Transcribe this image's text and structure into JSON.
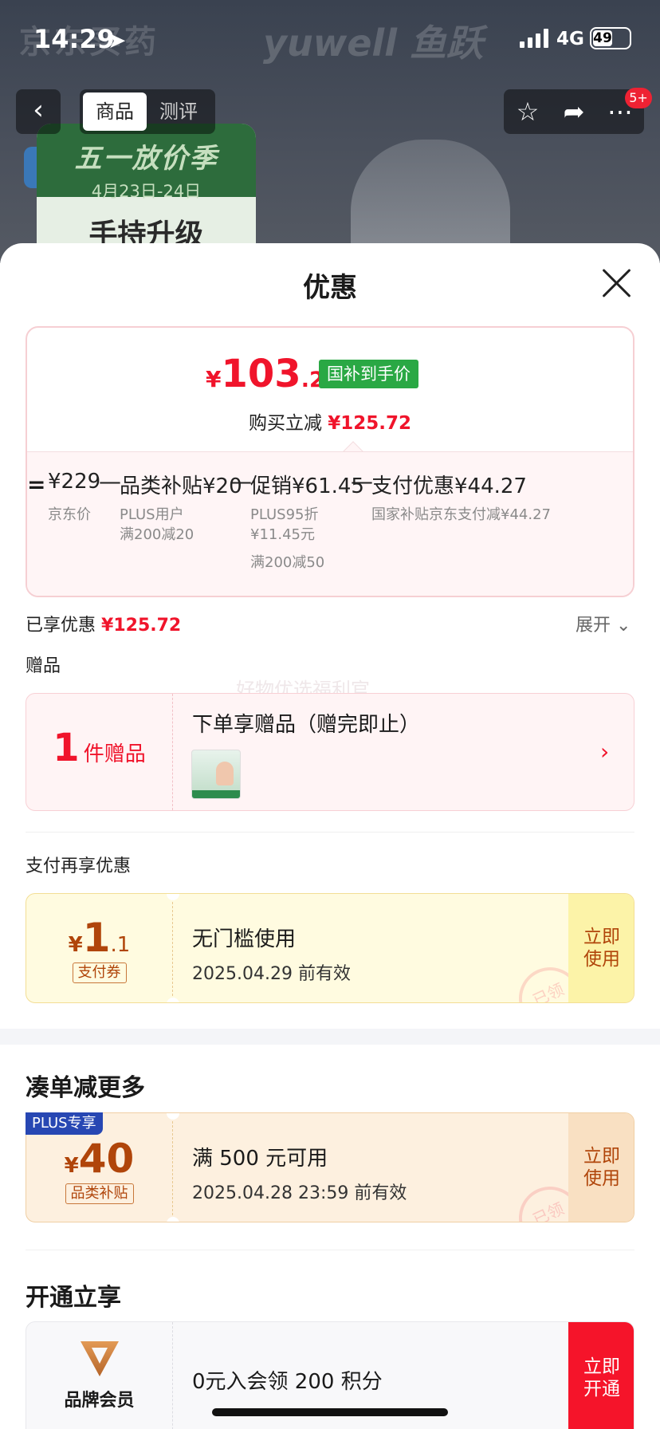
{
  "status_bar": {
    "time": "14:29",
    "network": "4G",
    "battery": "49"
  },
  "background": {
    "brand_left": "京东买药",
    "brand_right": "yuwell 鱼跃",
    "promo_title": "五一放价季",
    "promo_date": "4月23日-24日",
    "promo_sub": "手持升级"
  },
  "nav": {
    "tabs": [
      {
        "label": "商品"
      },
      {
        "label": "测评"
      }
    ],
    "badge": "5+"
  },
  "sheet": {
    "title": "优惠",
    "final_price": {
      "currency": "¥",
      "integer": "103",
      "decimal": ".28",
      "badge": "国补到手价",
      "sub_label": "购买立减",
      "sub_value": "¥125.72"
    },
    "breakdown": {
      "eq": "=",
      "jd_price": "¥229",
      "jd_price_label": "京东价",
      "cat_subsidy": "品类补贴¥20",
      "cat_note_1": "PLUS用户",
      "cat_note_2": "满200减20",
      "promo": "促销¥61.45",
      "promo_note_1": "PLUS95折",
      "promo_note_2": "¥11.45元",
      "promo_note_3": "满200减50",
      "pay": "支付优惠¥44.27",
      "pay_note": "国家补贴京东支付减¥44.27",
      "minus": "—"
    },
    "saved": {
      "label": "已享优惠",
      "value": "¥125.72",
      "expand": "展开"
    },
    "gift": {
      "heading": "赠品",
      "watermark": "好物优选福利官",
      "count": "1",
      "count_label": "件赠品",
      "title": "下单享赠品（赠完即止）"
    },
    "pay_section": {
      "heading": "支付再享优惠",
      "coupon": {
        "currency": "¥",
        "amount": "1",
        "decimal": ".1",
        "tag": "支付券",
        "main": "无门槛使用",
        "sub": "2025.04.29 前有效",
        "button": "立即\n使用",
        "stamp": "已领"
      }
    },
    "more_section": {
      "heading": "凑单减更多",
      "plus_tag": "PLUS专享",
      "coupon": {
        "currency": "¥",
        "amount": "40",
        "tag": "品类补贴",
        "main": "满 500 元可用",
        "sub": "2025.04.28 23:59 前有效",
        "button": "立即\n使用",
        "stamp": "已领"
      }
    },
    "open_section": {
      "heading": "开通立享",
      "member": {
        "label": "品牌会员",
        "text": "0元入会领 200 积分",
        "button": "立即\n开通"
      }
    }
  },
  "colors": {
    "accent_red": "#f0142b",
    "badge_green": "#2aa844",
    "coupon_brown": "#b0450a",
    "plus_blue": "#2747b3"
  }
}
